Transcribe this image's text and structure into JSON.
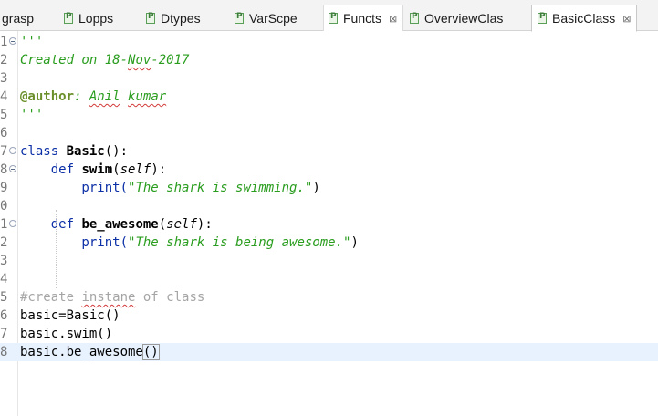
{
  "tabs": [
    {
      "label": "grasp",
      "icon": "python-file-icon",
      "active": false
    },
    {
      "label": "Lopps",
      "icon": "python-file-icon",
      "active": false
    },
    {
      "label": "Dtypes",
      "icon": "python-file-icon",
      "active": false
    },
    {
      "label": "VarScpe",
      "icon": "python-file-icon",
      "active": false
    },
    {
      "label": "Functs",
      "icon": "python-file-icon",
      "active": false,
      "closable": true
    },
    {
      "label": "OverviewClas",
      "icon": "python-file-icon",
      "active": false
    },
    {
      "label": "BasicClass",
      "icon": "python-file-icon",
      "active": true,
      "closable": true
    }
  ],
  "close_glyph": "⊠",
  "editor": {
    "line_numbers": [
      "1",
      "2",
      "3",
      "4",
      "5",
      "6",
      "7",
      "8",
      "9",
      "0",
      "1",
      "2",
      "3",
      "4",
      "5",
      "6",
      "7",
      "8"
    ],
    "lines": {
      "l1": "'''",
      "l2a": "Created on 18-",
      "l2b": "Nov",
      "l2c": "-2017",
      "l4a": "@author",
      "l4b": ": ",
      "l4c": "Anil",
      "l4d": " ",
      "l4e": "kumar",
      "l5": "'''",
      "l7a": "class ",
      "l7b": "Basic",
      "l7c": "():",
      "l8a": "    def ",
      "l8b": "swim",
      "l8c": "(",
      "l8d": "self",
      "l8e": "):",
      "l9a": "        print(",
      "l9b": "\"The shark is swimming.\"",
      "l9c": ")",
      "l11a": "    def ",
      "l11b": "be_awesome",
      "l11c": "(",
      "l11d": "self",
      "l11e": "):",
      "l12a": "        print(",
      "l12b": "\"The shark is being awesome.\"",
      "l12c": ")",
      "l15a": "#create ",
      "l15b": "instane",
      "l15c": " of class",
      "l16": "basic=Basic()",
      "l17": "basic.swim()",
      "l18a": "basic.be_awesome",
      "l18b": "()"
    },
    "current_line": 18
  },
  "colors": {
    "string": "#2a9d1f",
    "keyword": "#0b2fa6",
    "comment": "#a5a5a5",
    "current_line_bg": "#e8f2fe"
  }
}
